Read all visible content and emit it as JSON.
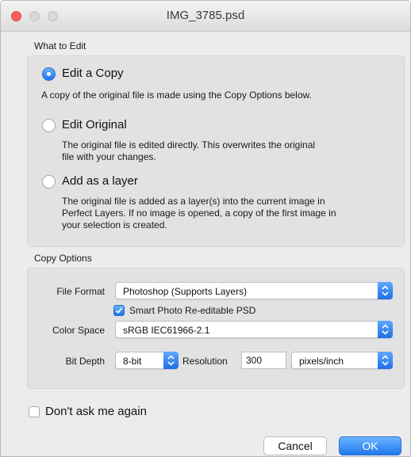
{
  "window": {
    "title": "IMG_3785.psd"
  },
  "what_to_edit": {
    "section_label": "What to Edit",
    "options": [
      {
        "label": "Edit a Copy",
        "selected": true,
        "description": "A copy of the original file is made using the Copy Options below."
      },
      {
        "label": "Edit Original",
        "selected": false,
        "description_lines": [
          "The original file is edited directly.  This overwrites the original",
          "file with your changes."
        ]
      },
      {
        "label": "Add as a layer",
        "selected": false,
        "description_lines": [
          "The original file is added as a layer(s) into the current image in",
          "Perfect Layers.  If no image is opened, a copy of the first image in",
          "your selection is created."
        ]
      }
    ]
  },
  "copy_options": {
    "section_label": "Copy Options",
    "file_format": {
      "label": "File Format",
      "value": "Photoshop (Supports Layers)"
    },
    "smart_photo": {
      "label": "Smart Photo Re-editable PSD",
      "checked": true
    },
    "color_space": {
      "label": "Color Space",
      "value": "sRGB IEC61966-2.1"
    },
    "bit_depth": {
      "label": "Bit Depth",
      "value": "8-bit"
    },
    "resolution": {
      "label": "Resolution",
      "value": "300",
      "unit": "pixels/inch"
    }
  },
  "dont_ask": {
    "label": "Don't ask me again",
    "checked": false
  },
  "buttons": {
    "cancel": "Cancel",
    "ok": "OK"
  },
  "colors": {
    "accent": "#1f6fe6",
    "close": "#fc605c",
    "panel": "#e2e2e2",
    "window": "#ececec"
  }
}
